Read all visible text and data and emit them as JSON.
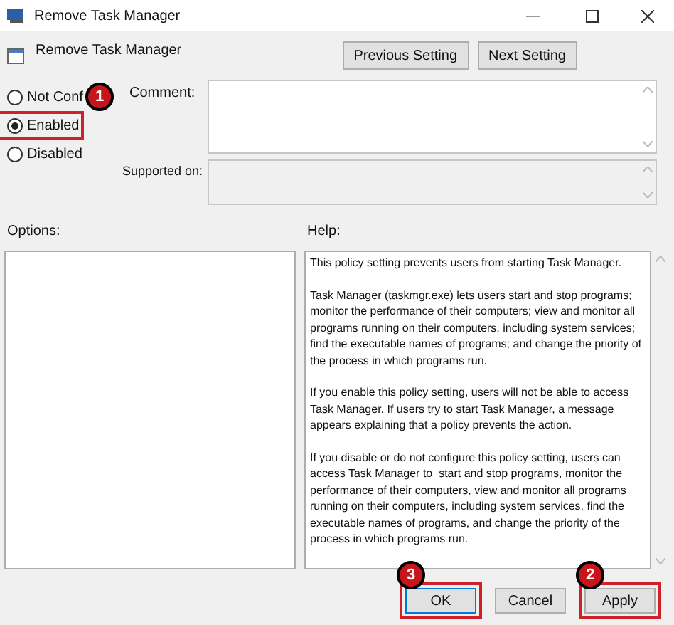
{
  "window": {
    "title": "Remove Task Manager"
  },
  "policy": {
    "name": "Remove Task Manager"
  },
  "nav_buttons": [
    "Previous Setting",
    "Next Setting"
  ],
  "state_options": [
    {
      "label": "Not Conf",
      "selected": false
    },
    {
      "label": "Enabled",
      "selected": true,
      "callout": "1"
    },
    {
      "label": "Disabled",
      "selected": false
    }
  ],
  "comment": {
    "label": "Comment:"
  },
  "supported_on": {
    "label": "Supported on:"
  },
  "options": {
    "label": "Options:"
  },
  "help": {
    "label": "Help:",
    "paragraphs": [
      "This policy setting prevents users from starting Task Manager.",
      "Task Manager (taskmgr.exe) lets users start and stop programs; monitor the performance of their computers; view and monitor all programs running on their computers, including system services; find the executable names of programs; and change the priority of the process in which programs run.",
      "If you enable this policy setting, users will not be able to access Task Manager. If users try to start Task Manager, a message appears explaining that a policy prevents the action.",
      "If you disable or do not configure this policy setting, users can access Task Manager to  start and stop programs, monitor the performance of their computers, view and monitor all programs running on their computers, including system services, find the executable names of programs, and change the priority of the process in which programs run."
    ]
  },
  "buttons": [
    {
      "label": "OK",
      "focused": true,
      "callout": "3"
    },
    {
      "label": "Cancel",
      "focused": false
    },
    {
      "label": "Apply",
      "focused": false,
      "callout": "2"
    }
  ]
}
